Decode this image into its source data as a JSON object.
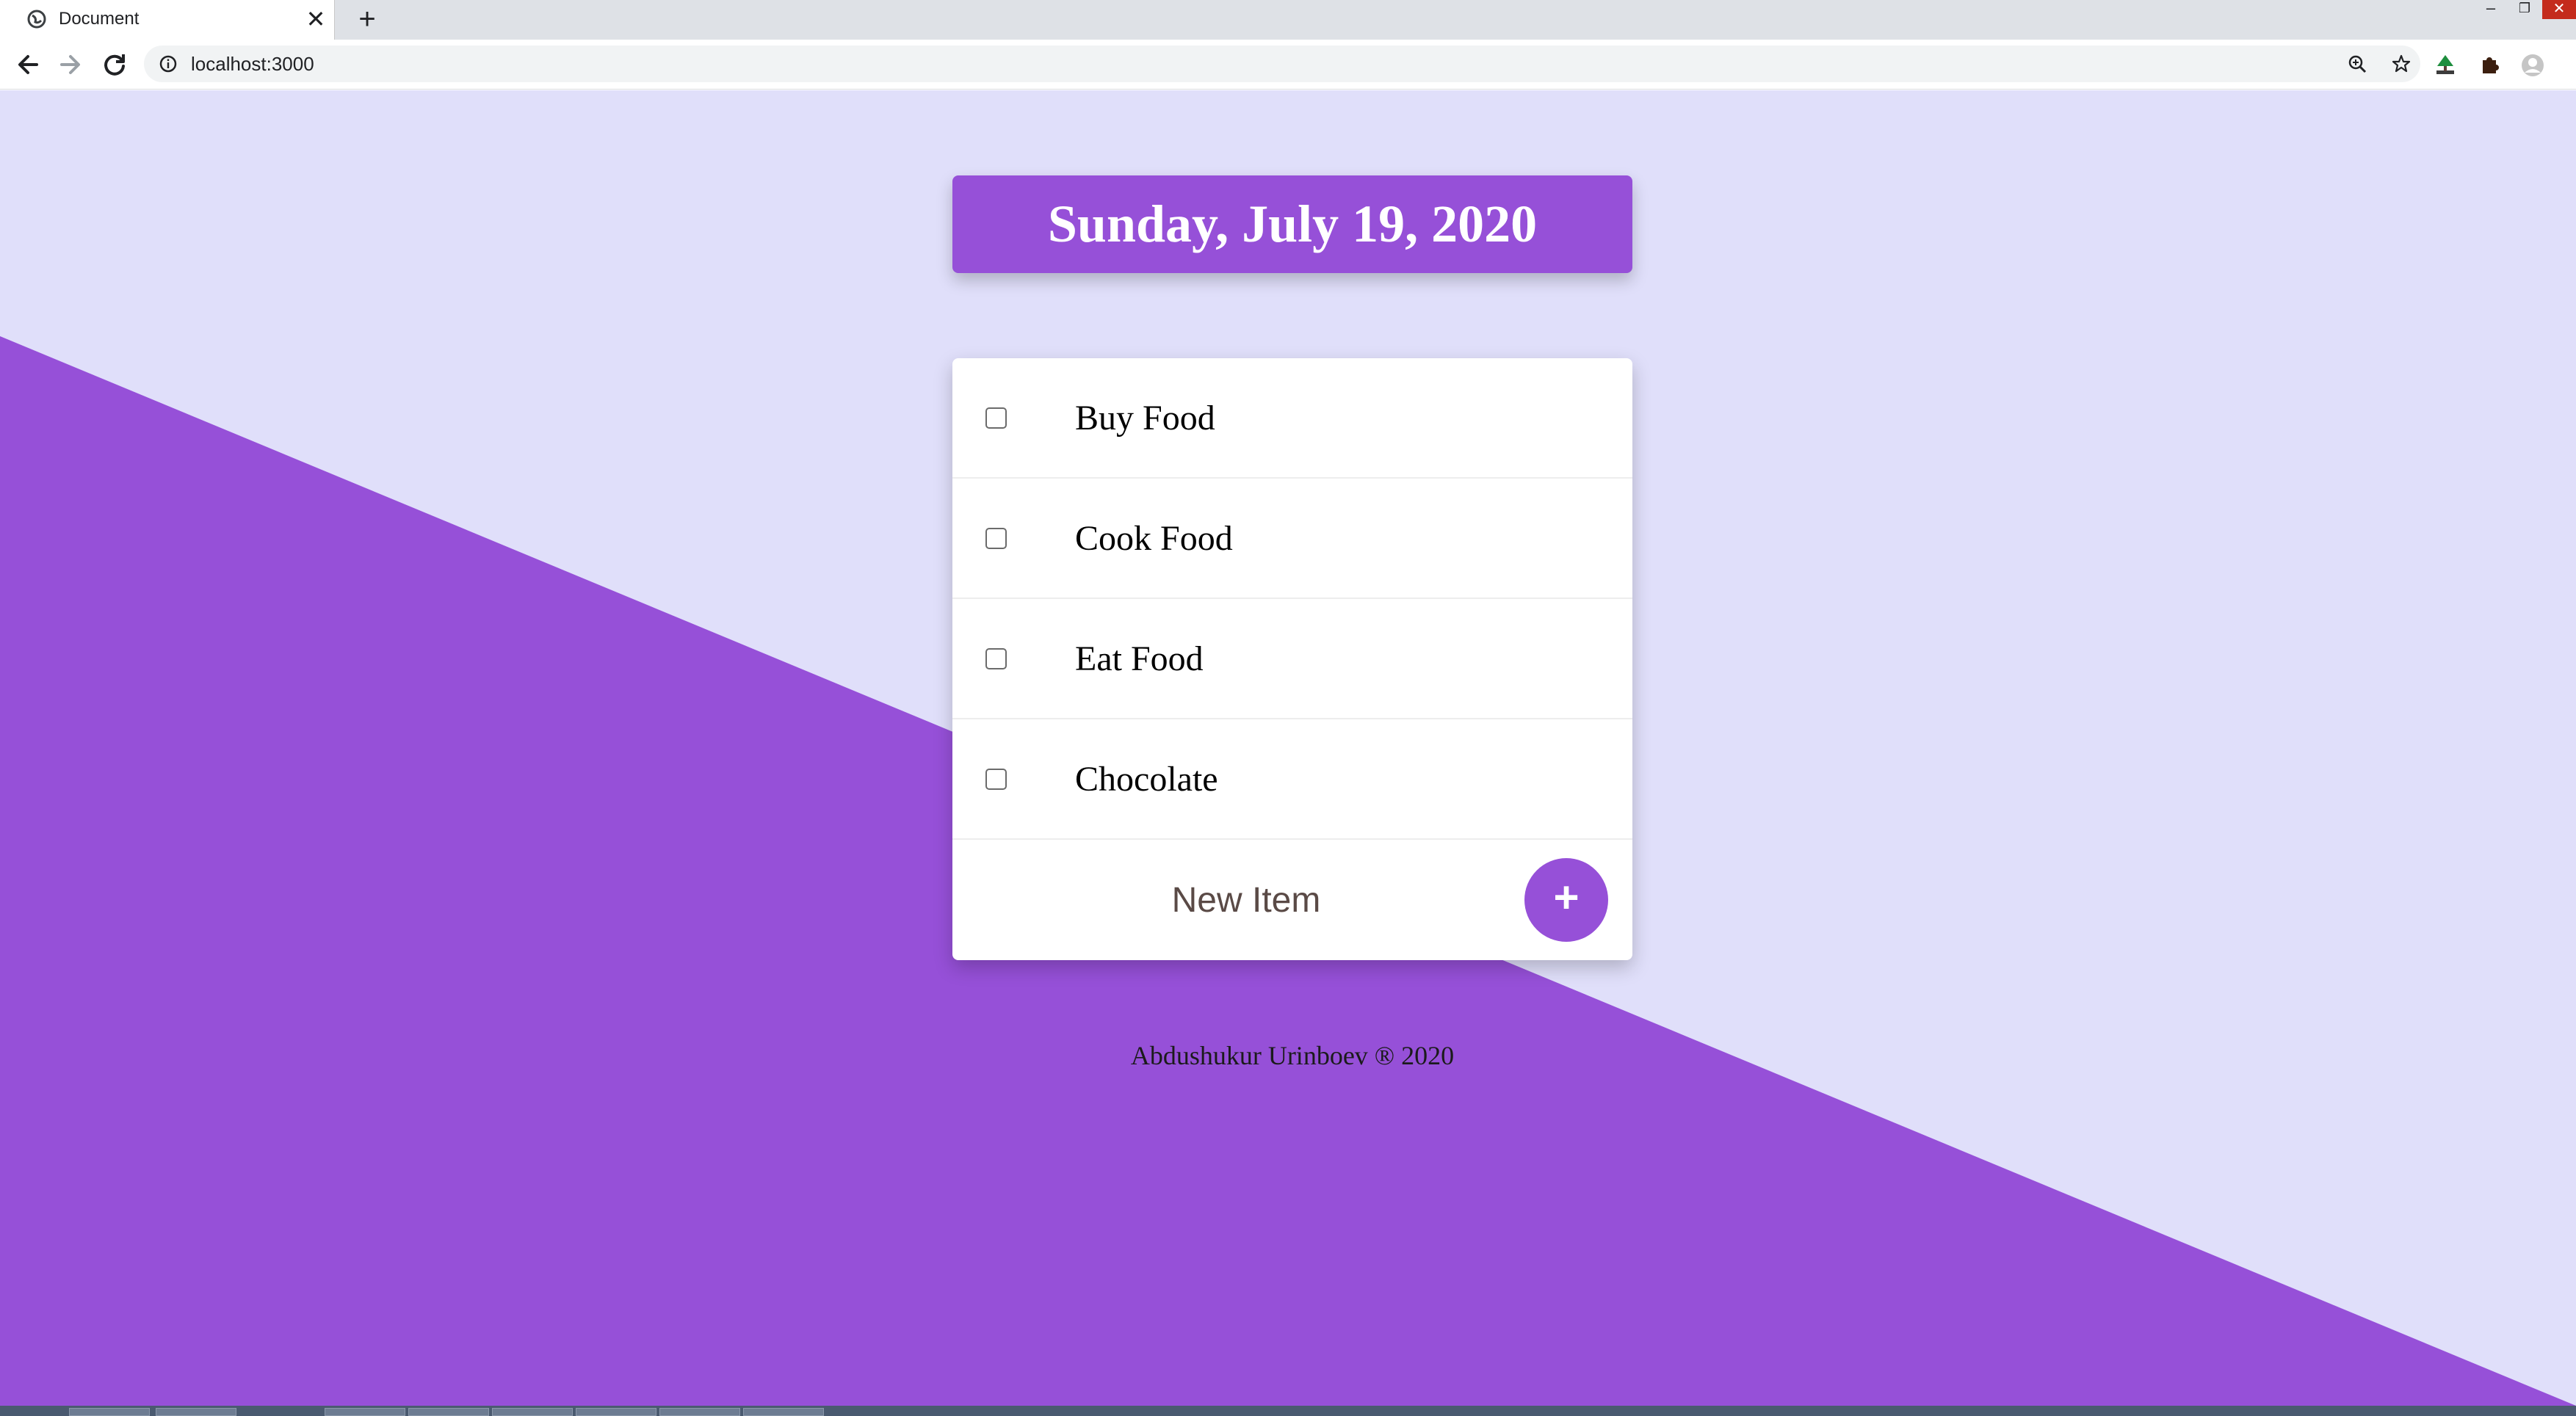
{
  "browser": {
    "tab_title": "Document",
    "tab_close": "✕",
    "new_tab": "+",
    "url": "localhost:3000",
    "window_minimize": "–",
    "window_restore": "❐",
    "window_close": "✕"
  },
  "page": {
    "date_heading": "Sunday, July 19, 2020",
    "items": [
      {
        "label": "Buy Food",
        "checked": false
      },
      {
        "label": "Cook Food",
        "checked": false
      },
      {
        "label": "Eat Food",
        "checked": false
      },
      {
        "label": "Chocolate",
        "checked": false
      }
    ],
    "new_item_placeholder": "New Item",
    "add_button_label": "+",
    "footer": "Abdushukur Urinboev ® 2020"
  },
  "colors": {
    "accent_purple": "#9650d8",
    "background_lavender": "#e0dffa",
    "card_white": "#ffffff"
  }
}
